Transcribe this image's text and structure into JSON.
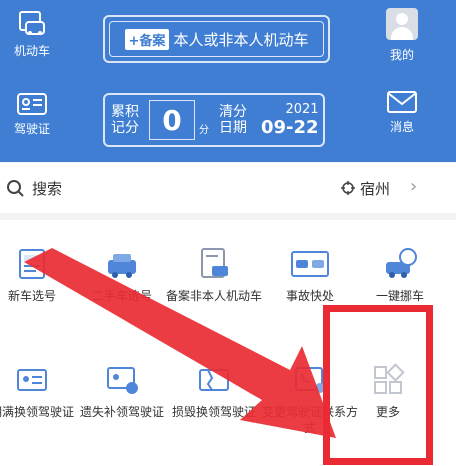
{
  "header": {
    "vehicle_label": "机动车",
    "license_label": "驾驶证",
    "profile_label": "我的",
    "message_label": "消息",
    "filing_badge": "+备案",
    "filing_text": "本人或非本人机动车",
    "points_label": "累积记分",
    "points_value": "0",
    "points_unit": "分",
    "clear_label": "清分日期",
    "clear_year": "2021",
    "clear_date": "09-22"
  },
  "search": {
    "placeholder": "搜索",
    "city": "宿州"
  },
  "services": [
    {
      "label": "新车选号"
    },
    {
      "label": "二手车选号"
    },
    {
      "label": "备案非本人机动车"
    },
    {
      "label": "事故快处"
    },
    {
      "label": "一键挪车"
    },
    {
      "label": "期满换领驾驶证"
    },
    {
      "label": "遗失补领驾驶证"
    },
    {
      "label": "损毁换领驾驶证"
    },
    {
      "label": "变更驾驶证联系方式"
    },
    {
      "label": "更多"
    }
  ],
  "colors": {
    "brand_blue": "#3f7ed3",
    "highlight_red": "#ea2b33"
  }
}
